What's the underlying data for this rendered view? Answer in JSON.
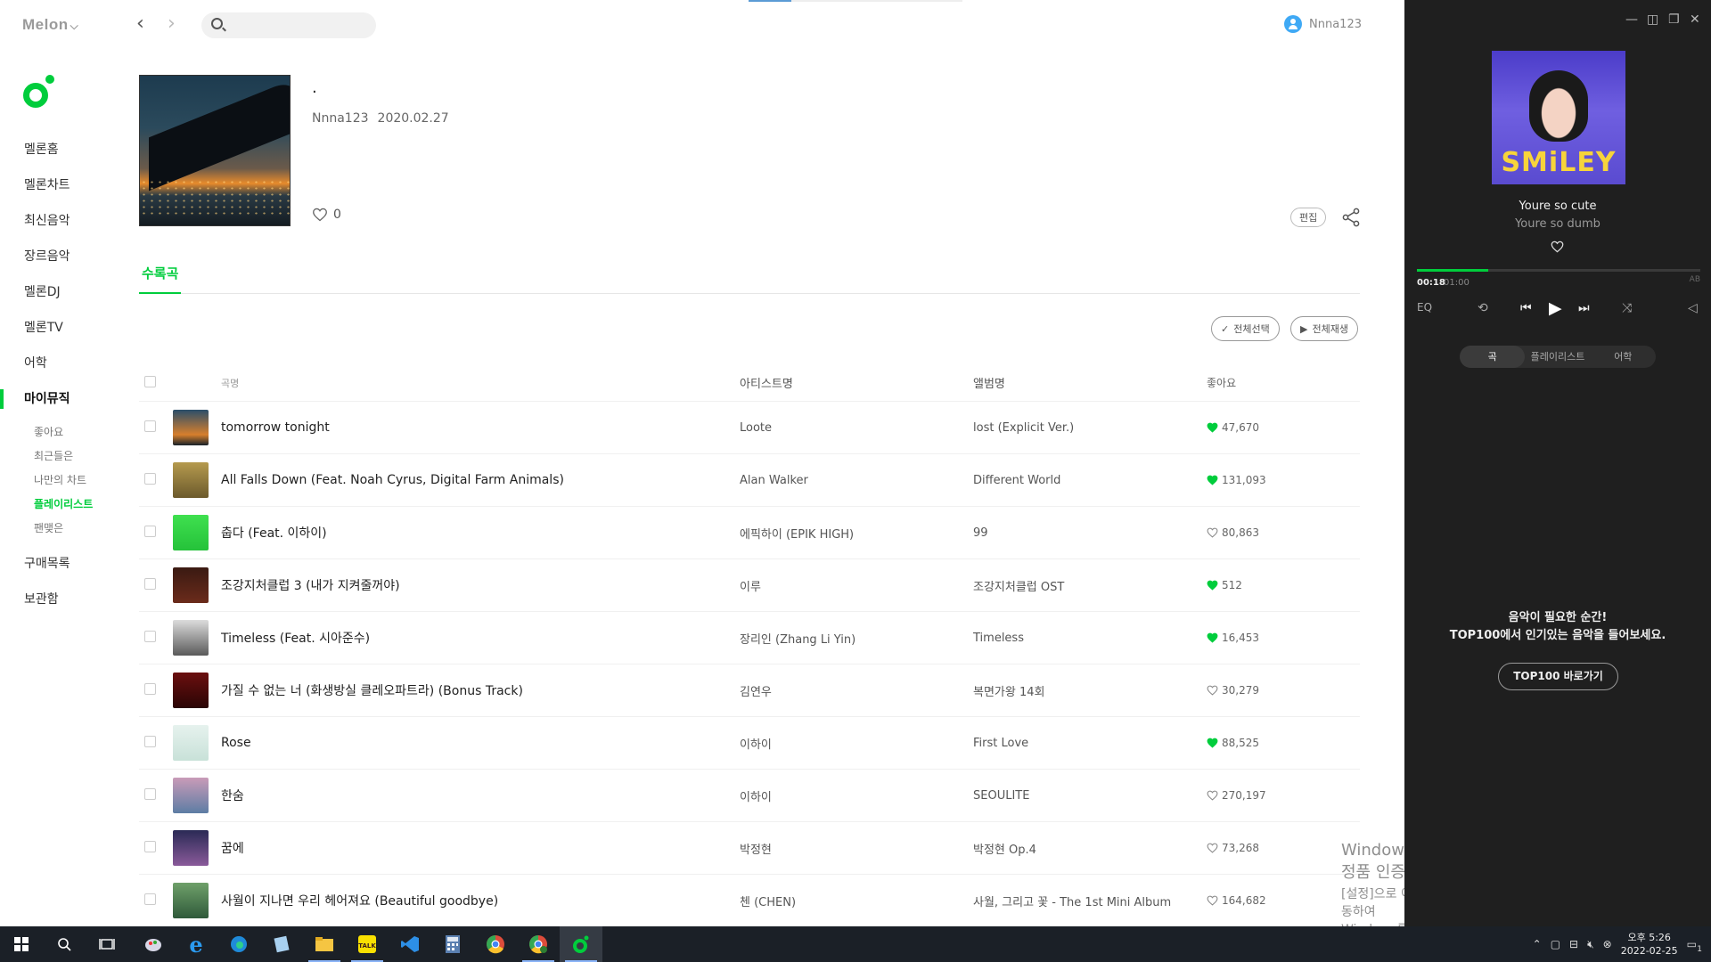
{
  "app": {
    "logo": "Melon"
  },
  "user": {
    "name": "Nnna123"
  },
  "search": {
    "placeholder": ""
  },
  "sidebar": {
    "items": [
      {
        "label": "멜론홈"
      },
      {
        "label": "멜론차트"
      },
      {
        "label": "최신음악"
      },
      {
        "label": "장르음악"
      },
      {
        "label": "멜론DJ"
      },
      {
        "label": "멜론TV"
      },
      {
        "label": "어학"
      },
      {
        "label": "마이뮤직"
      }
    ],
    "subitems": [
      {
        "label": "좋아요"
      },
      {
        "label": "최근들은"
      },
      {
        "label": "나만의 차트"
      },
      {
        "label": "플레이리스트"
      },
      {
        "label": "팬맺은"
      }
    ],
    "bottom": [
      {
        "label": "구매목록"
      },
      {
        "label": "보관함"
      }
    ]
  },
  "playlist": {
    "title": "·",
    "owner": "Nnna123",
    "date": "2020.02.27",
    "likes": "0",
    "edit_label": "편집"
  },
  "tabs": {
    "songs": "수록곡"
  },
  "actions": {
    "select_all": "전체선택",
    "play_all": "전체재생"
  },
  "table": {
    "headers": {
      "title": "곡명",
      "artist": "아티스트명",
      "album": "앨범명",
      "likes": "좋아요"
    },
    "rows": [
      {
        "title": "tomorrow tonight",
        "artist": "Loote",
        "album": "lost (Explicit Ver.)",
        "likes": "47,670",
        "liked": true
      },
      {
        "title": "All Falls Down (Feat. Noah Cyrus, Digital Farm Animals)",
        "artist": "Alan Walker",
        "album": "Different World",
        "likes": "131,093",
        "liked": true
      },
      {
        "title": "춥다 (Feat. 이하이)",
        "artist": "에픽하이 (EPIK HIGH)",
        "album": "99",
        "likes": "80,863",
        "liked": false
      },
      {
        "title": "조강지처클럽 3 (내가 지켜줄꺼야)",
        "artist": "이루",
        "album": "조강지처클럽 OST",
        "likes": "512",
        "liked": true
      },
      {
        "title": "Timeless (Feat. 시아준수)",
        "artist": "장리인 (Zhang Li Yin)",
        "album": "Timeless",
        "likes": "16,453",
        "liked": true
      },
      {
        "title": "가질 수 없는 너 (화생방실 클레오파트라) (Bonus Track)",
        "artist": "김연우",
        "album": "복면가왕 14회",
        "likes": "30,279",
        "liked": false
      },
      {
        "title": "Rose",
        "artist": "이하이",
        "album": "First Love",
        "likes": "88,525",
        "liked": true
      },
      {
        "title": "한숨",
        "artist": "이하이",
        "album": "SEOULITE",
        "likes": "270,197",
        "liked": false
      },
      {
        "title": "꿈에",
        "artist": "박정현",
        "album": "박정현 Op.4",
        "likes": "73,268",
        "liked": false
      },
      {
        "title": "사월이 지나면 우리 헤어져요 (Beautiful goodbye)",
        "artist": "첸 (CHEN)",
        "album": "사월, 그리고 꽃 - The 1st Mini Album",
        "likes": "164,682",
        "liked": false
      }
    ]
  },
  "player": {
    "cover_text": "SMiLEY",
    "title": "Youre so cute",
    "artist": "Youre so dumb",
    "current_time": "00:18",
    "total_time": "01:00",
    "progress": 0.25,
    "ab_label": "AB",
    "eq_label": "EQ",
    "tabs": [
      "곡",
      "플레이리스트",
      "어학"
    ],
    "promo_line1": "음악이 필요한 순간!",
    "promo_line2": "TOP100에서 인기있는 음악을 들어보세요.",
    "promo_button": "TOP100 바로가기"
  },
  "watermark": {
    "line1": "Windows 정품 인증",
    "line2": "[설정]으로 이동하여 Windows를 정품 인증합니다."
  },
  "taskbar": {
    "time": "오후 5:26",
    "date": "2022-02-25",
    "notification_count": "1"
  },
  "colors": {
    "accent": "#00cd3c",
    "player_bg": "#1f1f1f",
    "taskbar_bg": "#1b2027"
  }
}
